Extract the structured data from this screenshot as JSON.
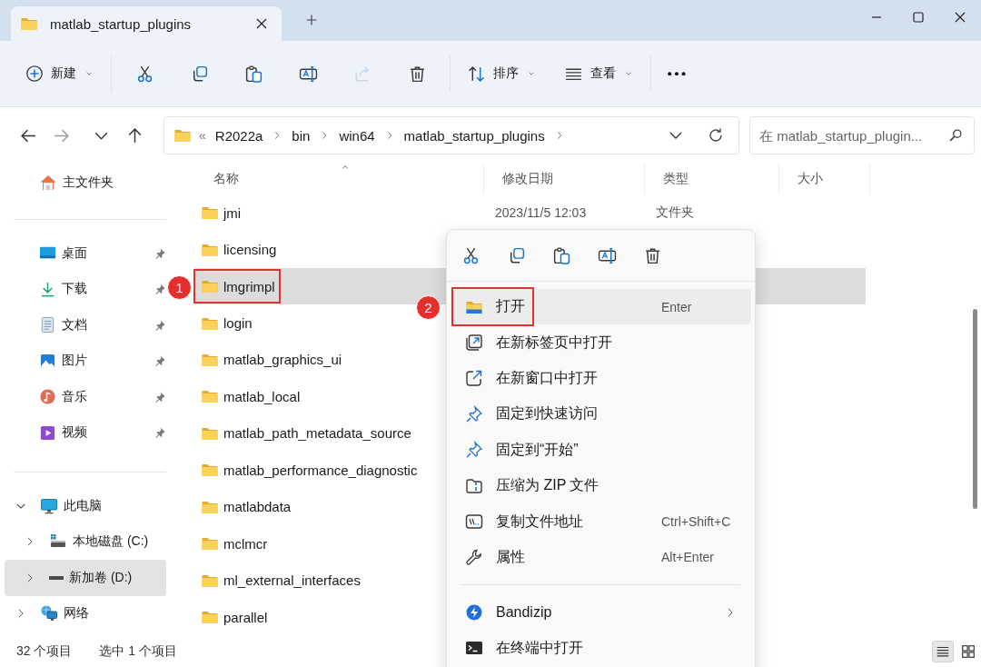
{
  "window": {
    "tab_title": "matlab_startup_plugins"
  },
  "toolbar": {
    "new_label": "新建",
    "actions": [
      {
        "disabled": false
      },
      {
        "disabled": false
      },
      {
        "disabled": false
      },
      {
        "disabled": false
      },
      {
        "disabled": true
      },
      {
        "disabled": false
      }
    ],
    "sort_label": "排序",
    "view_label": "查看"
  },
  "address": {
    "overflow": "«",
    "crumbs": [
      "R2022a",
      "bin",
      "win64",
      "matlab_startup_plugins"
    ],
    "search": {
      "placeholder": "在 matlab_startup_plugin..."
    }
  },
  "sidebar": {
    "home": {
      "label": "主文件夹"
    },
    "quick_access": [
      {
        "label": "桌面",
        "pinned": true
      },
      {
        "label": "下载",
        "pinned": true
      },
      {
        "label": "文档",
        "pinned": true
      },
      {
        "label": "图片",
        "pinned": true
      },
      {
        "label": "音乐",
        "pinned": true
      },
      {
        "label": "视频",
        "pinned": true
      }
    ],
    "tree": [
      {
        "label": "此电脑",
        "expanded": true,
        "selected": false,
        "children": [
          {
            "label": "本地磁盘 (C:)",
            "expanded": false,
            "selected": false
          },
          {
            "label": "新加卷 (D:)",
            "expanded": false,
            "selected": true
          }
        ]
      },
      {
        "label": "网络",
        "expanded": false,
        "selected": false
      }
    ]
  },
  "file_list": {
    "columns": [
      {
        "label": "名称",
        "sorted": true
      },
      {
        "label": "修改日期",
        "sorted": false
      },
      {
        "label": "类型",
        "sorted": false
      },
      {
        "label": "大小",
        "sorted": false
      }
    ],
    "rows": [
      {
        "name": "jmi",
        "modified": "2023/11/5 12:03",
        "type": "文件夹",
        "selected": false
      },
      {
        "name": "licensing",
        "selected": false
      },
      {
        "name": "lmgrimpl",
        "selected": true,
        "callout": "1"
      },
      {
        "name": "login",
        "selected": false
      },
      {
        "name": "matlab_graphics_ui",
        "selected": false
      },
      {
        "name": "matlab_local",
        "selected": false
      },
      {
        "name": "matlab_path_metadata_source",
        "selected": false
      },
      {
        "name": "matlab_performance_diagnostic",
        "selected": false
      },
      {
        "name": "matlabdata",
        "selected": false
      },
      {
        "name": "mclmcr",
        "selected": false
      },
      {
        "name": "ml_external_interfaces",
        "selected": false
      },
      {
        "name": "parallel",
        "selected": false
      }
    ]
  },
  "context_menu": {
    "items": [
      {
        "kind": "item",
        "label": "打开",
        "shortcut": "Enter",
        "selected": true,
        "callout": "2"
      },
      {
        "kind": "item",
        "label": "在新标签页中打开",
        "selected": false
      },
      {
        "kind": "item",
        "label": "在新窗口中打开",
        "selected": false
      },
      {
        "kind": "item",
        "label": "固定到快速访问",
        "selected": false
      },
      {
        "kind": "item",
        "label": "固定到“开始”",
        "selected": false
      },
      {
        "kind": "item",
        "label": "压缩为 ZIP 文件",
        "selected": false
      },
      {
        "kind": "item",
        "label": "复制文件地址",
        "shortcut": "Ctrl+Shift+C",
        "selected": false
      },
      {
        "kind": "item",
        "label": "属性",
        "shortcut": "Alt+Enter",
        "selected": false
      },
      {
        "kind": "separator"
      },
      {
        "kind": "submenu",
        "label": "Bandizip",
        "selected": false
      },
      {
        "kind": "item",
        "label": "在终端中打开",
        "selected": false
      }
    ]
  },
  "status_bar": {
    "item_count": "32 个项目",
    "selection": "选中 1 个项目",
    "view_buttons": [
      {
        "selected": true
      },
      {
        "selected": false
      }
    ]
  }
}
